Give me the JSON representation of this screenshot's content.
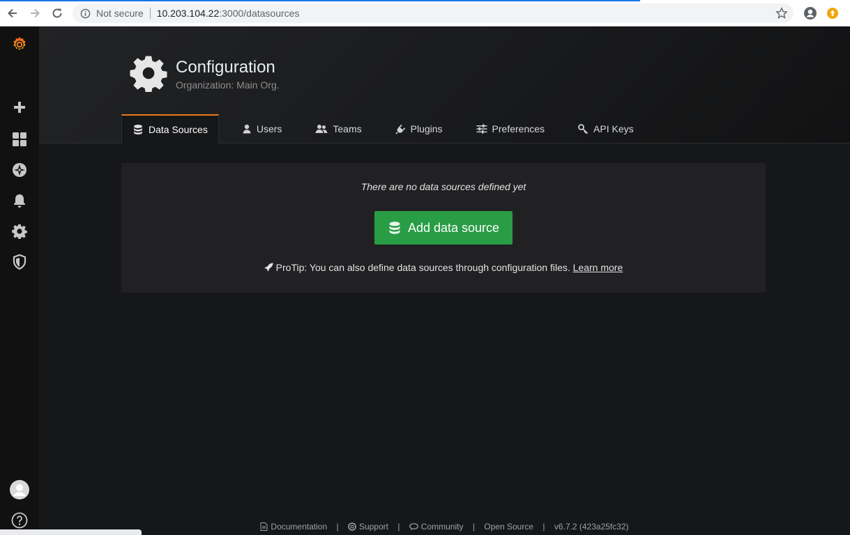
{
  "browser": {
    "security_label": "Not secure",
    "url_host": "10.203.104.22",
    "url_path": ":3000/datasources"
  },
  "sidemenu": {
    "items": [
      "grafana-logo",
      "create-plus-icon",
      "dashboards-grid-icon",
      "explore-compass-icon",
      "alerting-bell-icon",
      "configuration-gear-icon",
      "server-admin-shield-icon",
      "user-avatar",
      "help-icon"
    ]
  },
  "header": {
    "title": "Configuration",
    "subtitle": "Organization: Main Org."
  },
  "tabs": [
    {
      "label": "Data Sources",
      "active": true
    },
    {
      "label": "Users",
      "active": false
    },
    {
      "label": "Teams",
      "active": false
    },
    {
      "label": "Plugins",
      "active": false
    },
    {
      "label": "Preferences",
      "active": false
    },
    {
      "label": "API Keys",
      "active": false
    }
  ],
  "empty": {
    "message": "There are no data sources defined yet",
    "button_label": "Add data source",
    "protip_text": "ProTip: You can also define data sources through configuration files.",
    "protip_link": "Learn more"
  },
  "footer": {
    "documentation": "Documentation",
    "support": "Support",
    "community": "Community",
    "open_source": "Open Source",
    "version": "v6.7.2 (423a25fc32)"
  },
  "colors": {
    "accent": "#eb7b18",
    "primary_button": "#299c46",
    "background": "#161719"
  }
}
